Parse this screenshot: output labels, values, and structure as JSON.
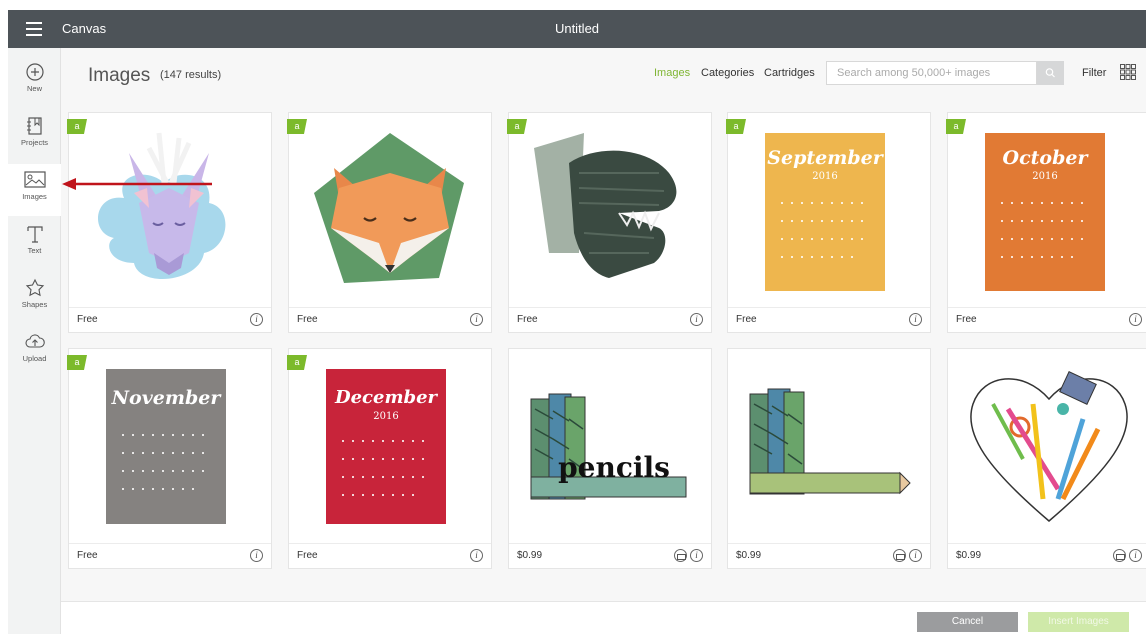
{
  "topbar": {
    "app_title": "Canvas",
    "doc_title": "Untitled"
  },
  "sidebar": {
    "items": [
      {
        "label": "New",
        "icon": "plus-circle-icon"
      },
      {
        "label": "Projects",
        "icon": "projects-icon"
      },
      {
        "label": "Images",
        "icon": "image-icon",
        "active": true
      },
      {
        "label": "Text",
        "icon": "text-icon"
      },
      {
        "label": "Shapes",
        "icon": "shapes-icon"
      },
      {
        "label": "Upload",
        "icon": "upload-cloud-icon"
      }
    ]
  },
  "header": {
    "title": "Images",
    "count": "(147 results)",
    "tabs": [
      {
        "label": "Images",
        "active": true
      },
      {
        "label": "Categories"
      },
      {
        "label": "Cartridges"
      }
    ],
    "search_placeholder": "Search among 50,000+ images",
    "filter_label": "Filter"
  },
  "badge_text": "a",
  "cards": [
    {
      "image": "deer-head",
      "price": "Free",
      "badge": true
    },
    {
      "image": "fox-head",
      "price": "Free",
      "badge": true
    },
    {
      "image": "dinosaur-head",
      "price": "Free",
      "badge": true
    },
    {
      "image": "calendar",
      "calendar_title": "September",
      "calendar_year": "2016",
      "price": "Free",
      "badge": true
    },
    {
      "image": "calendar",
      "calendar_title": "October",
      "calendar_year": "2016",
      "price": "Free",
      "badge": true
    },
    {
      "image": "calendar",
      "calendar_title": "November",
      "calendar_year": "",
      "price": "Free",
      "badge": true
    },
    {
      "image": "calendar",
      "calendar_title": "December",
      "calendar_year": "2016",
      "price": "Free",
      "badge": true
    },
    {
      "image": "pencils-word",
      "image_text": "pencils",
      "price": "$0.99",
      "badge": false,
      "printable": true
    },
    {
      "image": "pencils-l",
      "price": "$0.99",
      "badge": false,
      "printable": true
    },
    {
      "image": "supplies-heart",
      "price": "$0.99",
      "badge": false,
      "printable": true
    }
  ],
  "footer": {
    "cancel_label": "Cancel",
    "insert_label": "Insert Images"
  },
  "colors": {
    "topbar": "#4d5358",
    "accent": "#7fb533",
    "arrow": "#c0141b",
    "september": "#eeb64e",
    "october": "#e17a34",
    "november": "#858280",
    "december": "#c8243a"
  }
}
